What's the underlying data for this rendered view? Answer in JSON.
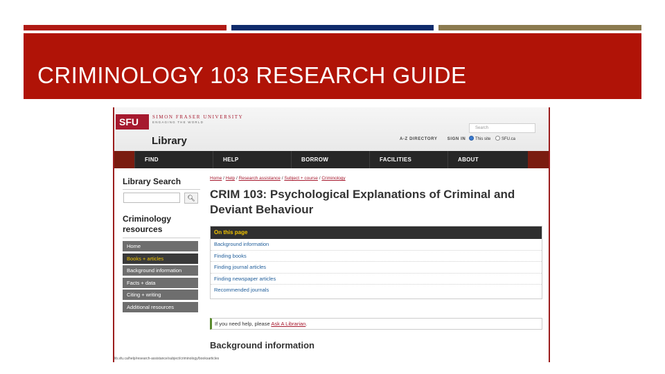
{
  "slide": {
    "title": "CRIMINOLOGY 103 RESEARCH GUIDE",
    "colors": {
      "red": "#b01307",
      "navy": "#0f2b6b",
      "gold": "#8b7a4f"
    }
  },
  "header": {
    "logo_text": "SFU",
    "university_name": "SIMON FRASER UNIVERSITY",
    "tagline": "ENGAGING THE WORLD",
    "library_title": "Library",
    "top_links": [
      "A-Z DIRECTORY",
      "SIGN IN"
    ],
    "search_placeholder": "Search",
    "scope_options": [
      {
        "label": "This site",
        "selected": true
      },
      {
        "label": "SFU.ca",
        "selected": false
      }
    ]
  },
  "nav": {
    "items": [
      "FIND",
      "HELP",
      "BORROW",
      "FACILITIES",
      "ABOUT"
    ]
  },
  "sidebar": {
    "search_title": "Library Search",
    "search_icon": "search-icon",
    "resources_title": "Criminology resources",
    "menu": [
      {
        "label": "Home",
        "active": false
      },
      {
        "label": "Books + articles",
        "active": true
      },
      {
        "label": "Background information",
        "active": false
      },
      {
        "label": "Facts + data",
        "active": false
      },
      {
        "label": "Citing + writing",
        "active": false
      },
      {
        "label": "Additional resources",
        "active": false
      }
    ]
  },
  "main": {
    "breadcrumbs": [
      "Home",
      "Help",
      "Research assistance",
      "Subject + course",
      "Criminology"
    ],
    "page_title": "CRIM 103: Psychological Explanations of Criminal and Deviant Behaviour",
    "on_this_page": {
      "heading": "On this page",
      "links": [
        "Background information",
        "Finding books",
        "Finding journal articles",
        "Finding newspaper articles",
        "Recommended journals"
      ]
    },
    "help": {
      "text": "If you need help, please ",
      "link": "Ask A Librarian",
      "end": "."
    },
    "section_heading": "Background information"
  },
  "status_url": "lib.sfu.ca/help/research-assistance/subject/criminology/booksarticles"
}
